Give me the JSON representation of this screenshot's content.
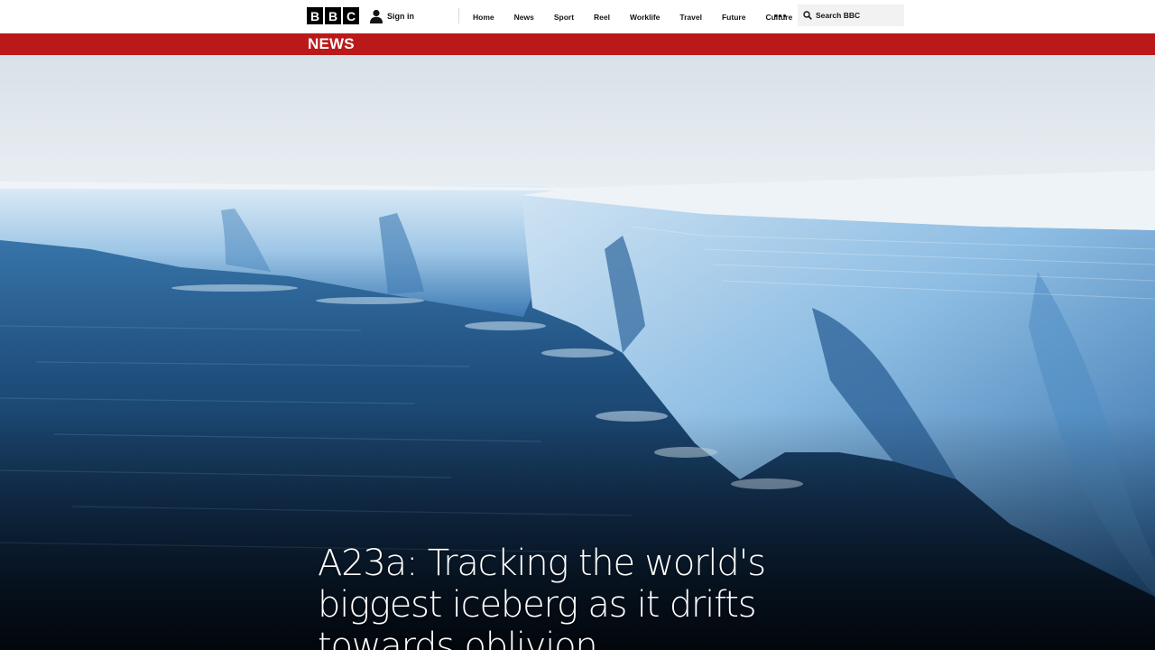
{
  "header": {
    "logo_letters": [
      "B",
      "B",
      "C"
    ],
    "sign_in_label": "Sign in",
    "nav": [
      "Home",
      "News",
      "Sport",
      "Reel",
      "Worklife",
      "Travel",
      "Future",
      "Culture"
    ],
    "search_placeholder": "Search BBC"
  },
  "section": {
    "label": "NEWS",
    "color": "#bb1919"
  },
  "hero": {
    "headline": "A23a: Tracking the world's biggest iceberg as it drifts towards oblivion"
  },
  "icons": {
    "user": "user-icon",
    "more": "more-dots-icon",
    "search": "search-icon"
  }
}
